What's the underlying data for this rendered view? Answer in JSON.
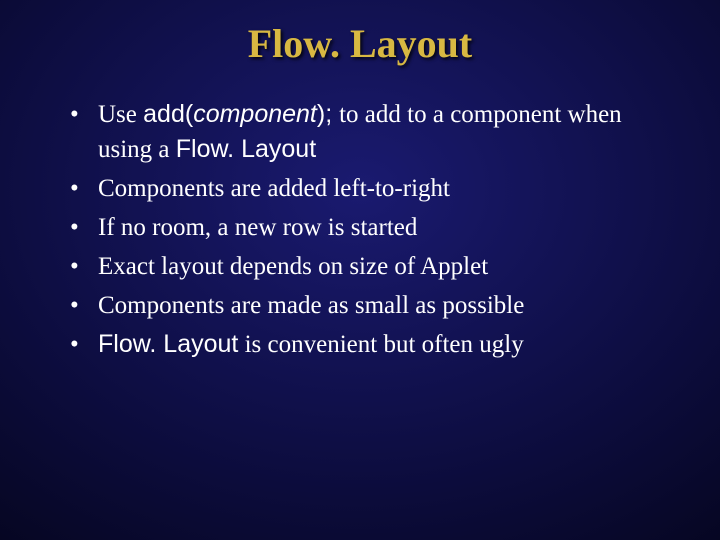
{
  "title": "Flow. Layout",
  "bullets": {
    "b1": {
      "t1": "Use  ",
      "code1a": "add(",
      "code1b": "component",
      "code1c": "); ",
      "t2": "  to add to a component when using a ",
      "code2": "Flow. Layout"
    },
    "b2": "Components are added left-to-right",
    "b3": "If no room, a new row is started",
    "b4": "Exact layout depends on size of Applet",
    "b5": "Components are made as small as possible",
    "b6": {
      "code": "Flow. Layout",
      "t": " is convenient but often ugly"
    }
  }
}
